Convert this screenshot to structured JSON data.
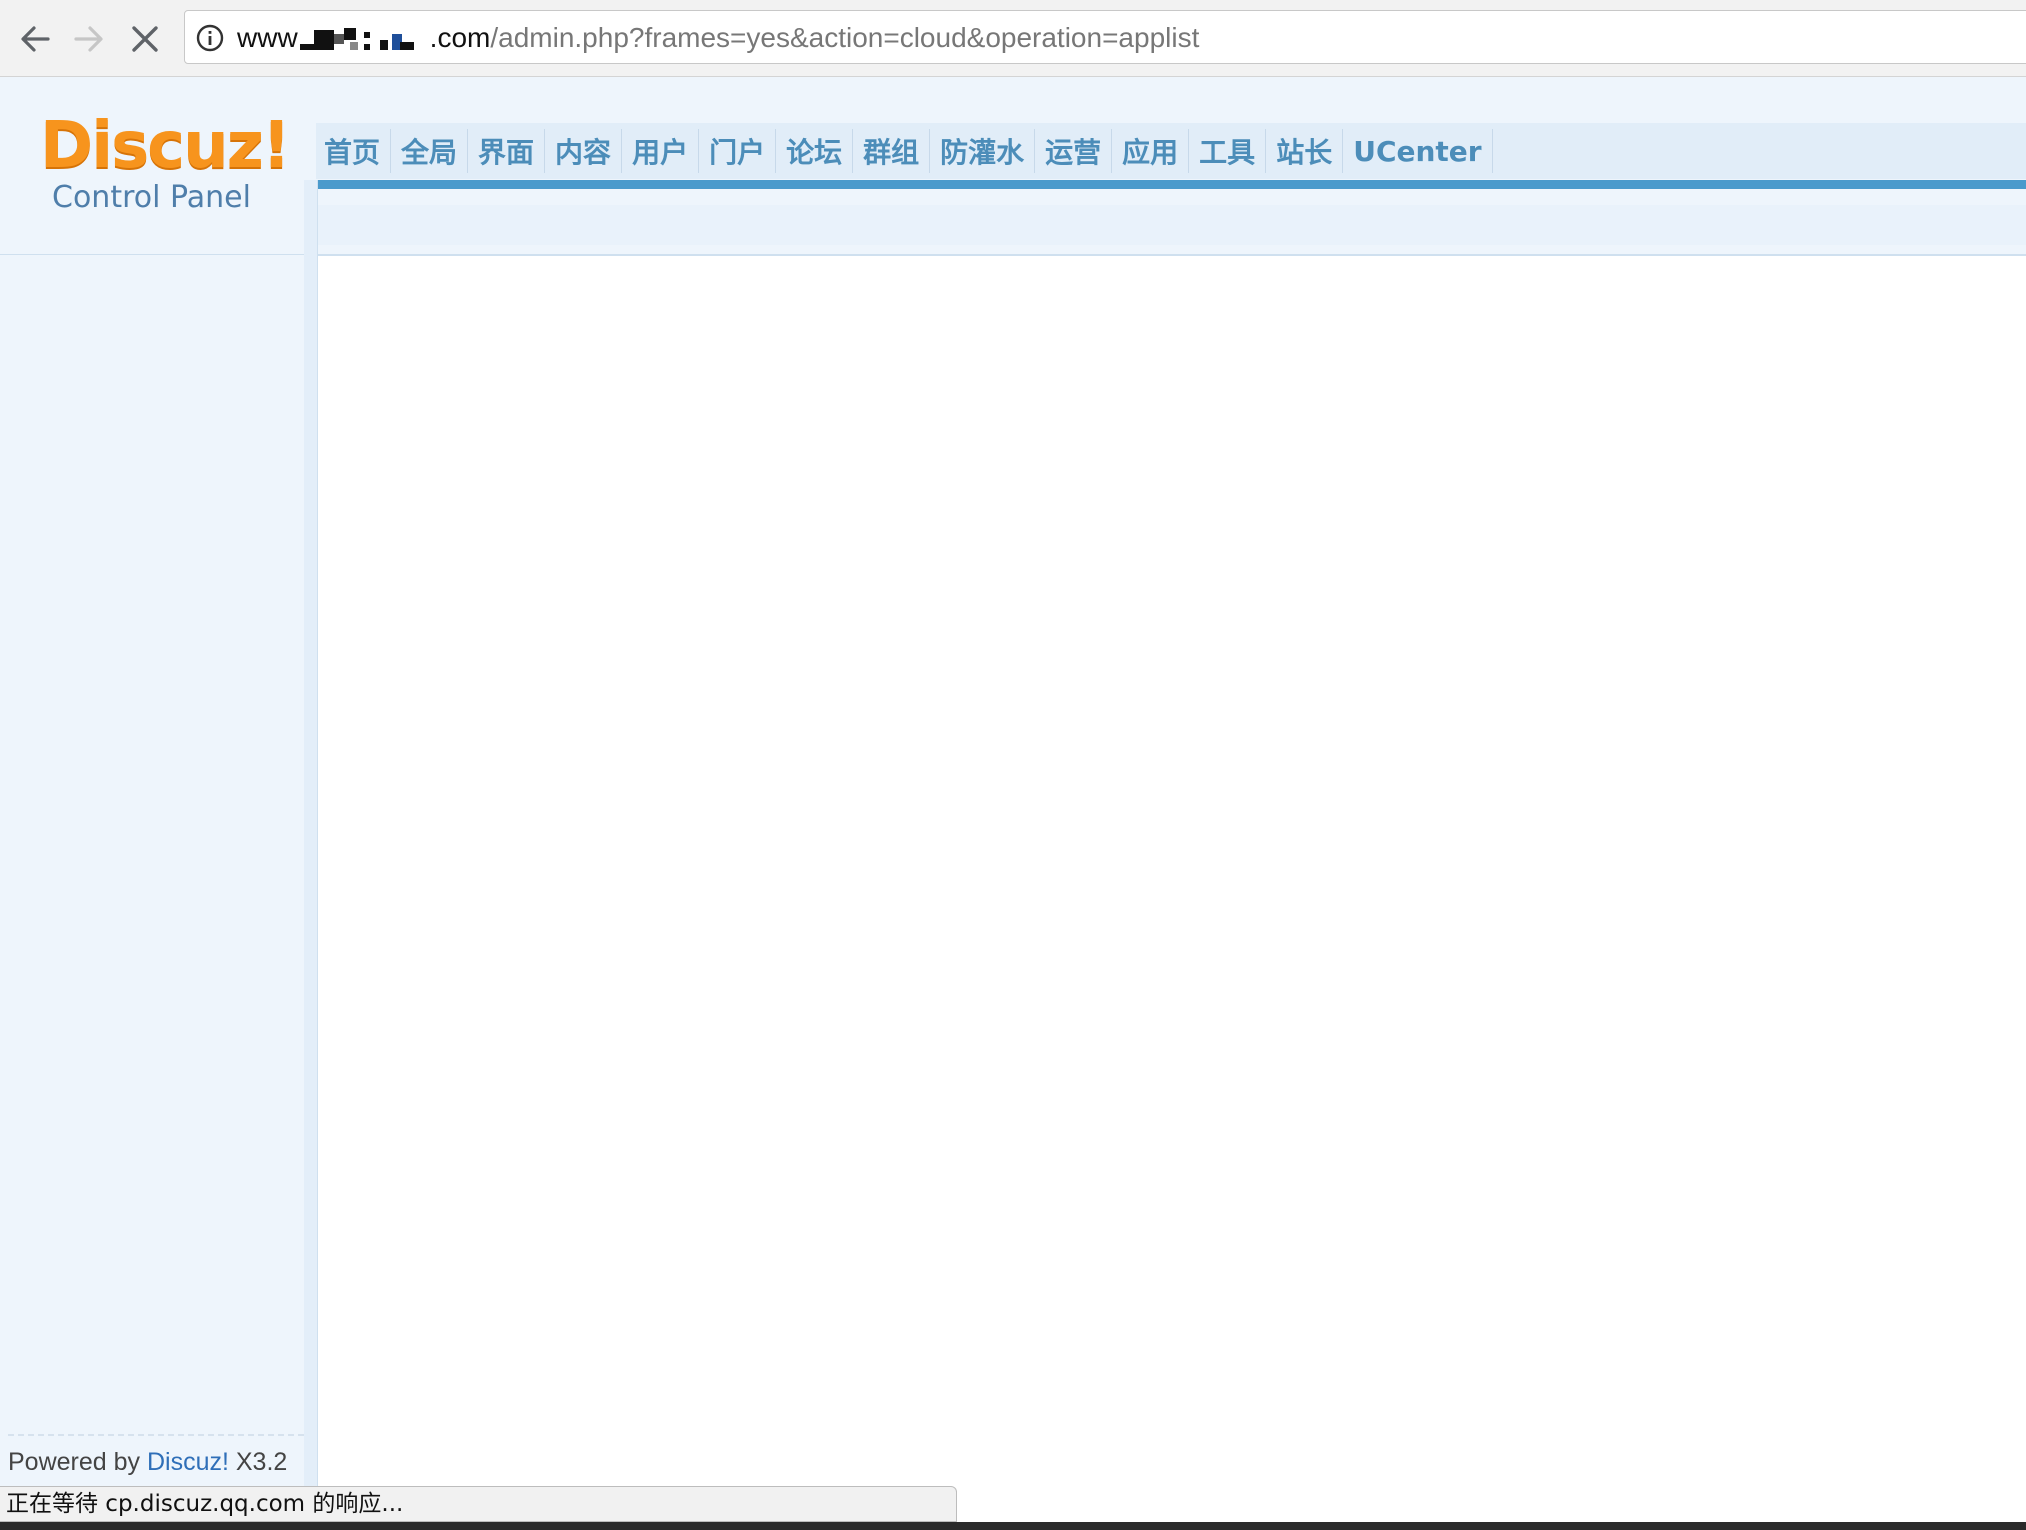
{
  "browser": {
    "url_host_start": "www",
    "url_host_end": ".com",
    "url_path": "/admin.php?frames=yes&action=cloud&operation=applist",
    "status_text": "正在等待 cp.discuz.qq.com 的响应..."
  },
  "logo": {
    "main": "Discuz!",
    "sub": "Control Panel"
  },
  "nav": {
    "items": [
      {
        "label": "首页"
      },
      {
        "label": "全局"
      },
      {
        "label": "界面"
      },
      {
        "label": "内容"
      },
      {
        "label": "用户"
      },
      {
        "label": "门户"
      },
      {
        "label": "论坛"
      },
      {
        "label": "群组"
      },
      {
        "label": "防灌水"
      },
      {
        "label": "运营"
      },
      {
        "label": "应用"
      },
      {
        "label": "工具"
      },
      {
        "label": "站长"
      },
      {
        "label": "UCenter"
      }
    ]
  },
  "footer": {
    "prefix": "Powered by ",
    "brand": "Discuz!",
    "version": " X3.2"
  },
  "colors": {
    "logo_orange": "#f7941d",
    "nav_blue": "#4c8db9",
    "accent_rule": "#4a9acc",
    "panel_bg": "#eef5fc"
  }
}
